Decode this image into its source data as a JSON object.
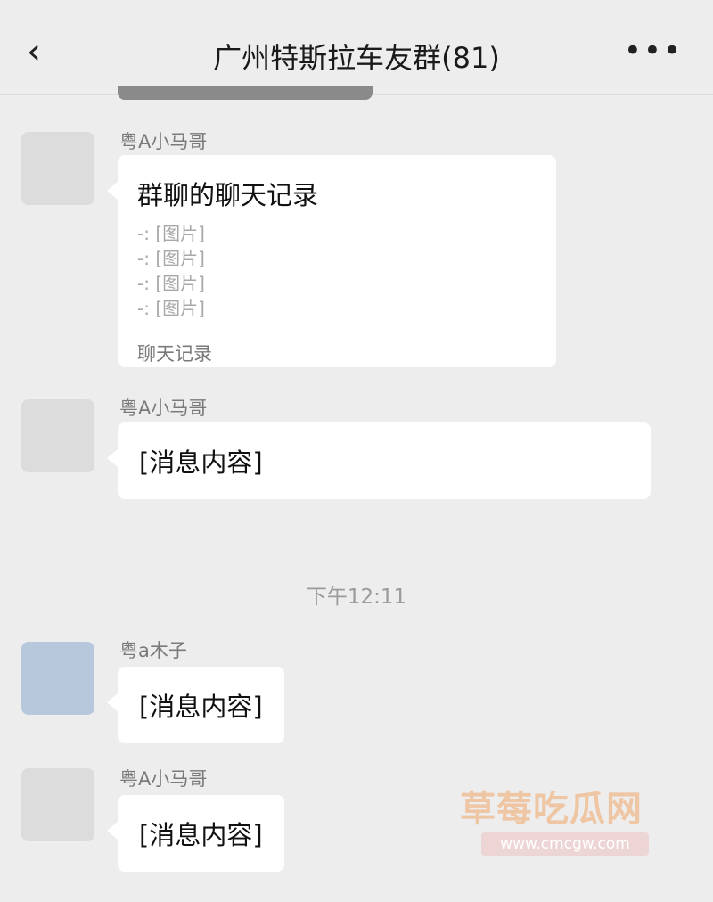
{
  "header": {
    "back_icon": "chevron-left-icon",
    "title": "广州特斯拉车友群(81)",
    "more_icon": "more-dots-icon"
  },
  "messages": [
    {
      "sender": "粤A小马哥",
      "type": "forward_card",
      "card": {
        "title": "群聊的聊天记录",
        "lines": [
          "-: [图片]",
          "-: [图片]",
          "-: [图片]",
          "-: [图片]"
        ],
        "footer": "聊天记录"
      }
    },
    {
      "sender": "粤A小马哥",
      "type": "text",
      "text": "[消息内容]"
    },
    {
      "sender": "粤a木子",
      "type": "text",
      "text": "[消息内容]"
    },
    {
      "sender": "粤A小马哥",
      "type": "text",
      "text": "[消息内容]"
    }
  ],
  "timestamp": "下午12:11",
  "watermark": {
    "text": "草莓吃瓜网",
    "url": "www.cmcgw.com"
  }
}
